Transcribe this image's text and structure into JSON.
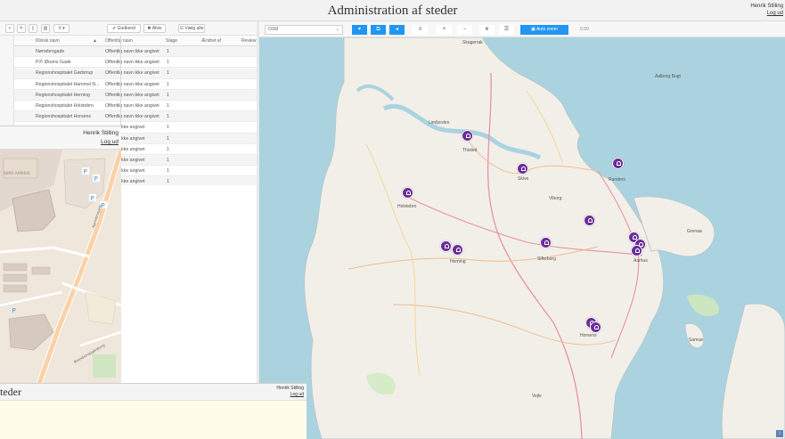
{
  "header": {
    "title": "Administration af steder",
    "user_name": "Henrik Stilling",
    "logout": "Log ud"
  },
  "toolbar": {
    "add_icon": "plus-icon",
    "edit_icon": "pencil-icon",
    "copy_icon": "document-icon",
    "delete_icon": "trash-icon",
    "search_icon": "search-icon",
    "approve": "✔ Godkend",
    "reject": "✖ Afvis",
    "select_all": "☑ Vælg alle"
  },
  "table": {
    "columns": [
      "Klinisk navn",
      "Offentlig navn",
      "Stage",
      "Ændret af",
      "Review"
    ],
    "rows": [
      [
        "Nørrebrogade",
        "Offentlig navn ikke angivet",
        "1"
      ],
      [
        "P.P. Ørums Gade",
        "Offentlig navn ikke angivet",
        "1"
      ],
      [
        "Regionshospitalet Gødstrup",
        "Offentlig navn ikke angivet",
        "1"
      ],
      [
        "Regionshospitalet Hammel N...",
        "Offentlig navn ikke angivet",
        "1"
      ],
      [
        "Regionshospitalet Herning",
        "Offentlig navn ikke angivet",
        "1"
      ],
      [
        "Regionshospitalet Holstebro",
        "Offentlig navn ikke angivet",
        "1"
      ],
      [
        "Regionshospitalet Horsens",
        "Offentlig navn ikke angivet",
        "1"
      ],
      [
        "",
        "g navn ikke angivet",
        "1"
      ],
      [
        "",
        "g navn ikke angivet",
        "1"
      ],
      [
        "",
        "g navn ikke angivet",
        "1"
      ],
      [
        "",
        "g navn ikke angivet",
        "1"
      ],
      [
        "",
        "g navn ikke angivet",
        "1"
      ],
      [
        "",
        "g navn ikke angivet",
        "1"
      ]
    ]
  },
  "map_toolbar": {
    "layer": "OSM",
    "auto_zoom": "Auto zoom",
    "zoom_value": "0.00",
    "buttons": [
      "pin-icon",
      "layers-icon",
      "arrow-left-icon",
      "list-icon",
      "zoom-in-icon",
      "zoom-out-icon",
      "filter-icon",
      "list-filter-icon"
    ]
  },
  "map": {
    "labels": [
      "Skagerrak",
      "Aalborg Bugt",
      "Samsø",
      "Limfjorden",
      "Thisted",
      "Skive",
      "Viborg",
      "Randers",
      "Holstebro",
      "Herning",
      "Silkeborg",
      "Aarhus",
      "Horsens",
      "Vejle",
      "Grenaa"
    ],
    "marker_count": 13,
    "attribution_icon": "info-icon"
  },
  "window2": {
    "user_name": "Henrik Stilling",
    "logout": "Log ud",
    "street_label": "Nørrebrogade",
    "street_label2": "Brendstrupgårdsvej",
    "place_label": "SHRO AARHUS"
  },
  "window3": {
    "title_fragment": "teder",
    "user_name": "Henrik Stilling",
    "logout": "Log ud"
  }
}
